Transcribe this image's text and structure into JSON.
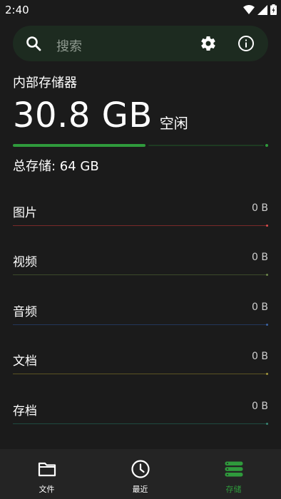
{
  "status_bar": {
    "time": "2:40"
  },
  "search": {
    "placeholder": "搜索"
  },
  "storage": {
    "title": "内部存储器",
    "free_value": "30.8 GB",
    "free_label": "空闲",
    "used_fraction": 0.52,
    "total_label": "总存储: 64 GB"
  },
  "categories": [
    {
      "label": "图片",
      "size": "0 B",
      "color": "#7a2a2a"
    },
    {
      "label": "视频",
      "size": "0 B",
      "color": "#3c4a2a"
    },
    {
      "label": "音频",
      "size": "0 B",
      "color": "#22375a"
    },
    {
      "label": "文档",
      "size": "0 B",
      "color": "#5a5322"
    },
    {
      "label": "存档",
      "size": "0 B",
      "color": "#1f4a40"
    }
  ],
  "nav": {
    "files": "文件",
    "recent": "最近",
    "storage": "存储"
  },
  "colors": {
    "accent": "#2f9a3c",
    "background": "#1b1b1b"
  }
}
